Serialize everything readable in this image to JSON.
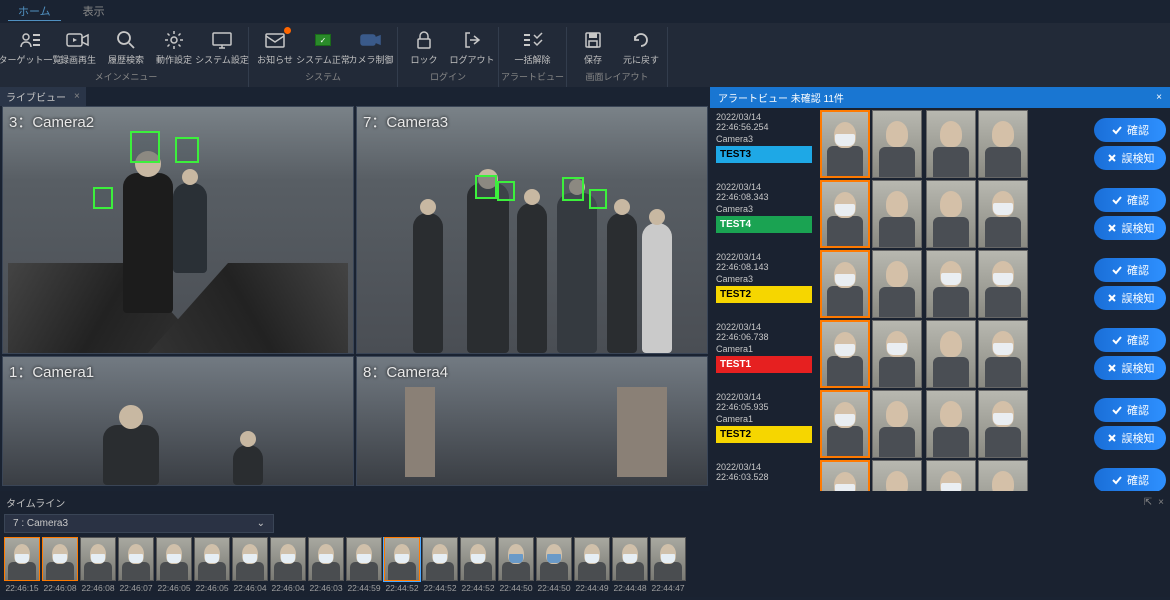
{
  "tabs": {
    "home": "ホーム",
    "view": "表示"
  },
  "toolbar": {
    "groups": [
      {
        "name": "メインメニュー",
        "items": [
          {
            "id": "target-list",
            "label": "ターゲット一覧"
          },
          {
            "id": "record-play",
            "label": "録画再生"
          },
          {
            "id": "history-search",
            "label": "履歴検索"
          },
          {
            "id": "action-settings",
            "label": "動作設定"
          },
          {
            "id": "system-settings",
            "label": "システム設定"
          }
        ]
      },
      {
        "name": "システム",
        "items": [
          {
            "id": "notice",
            "label": "お知らせ",
            "badge": true
          },
          {
            "id": "system-ok",
            "label": "システム正常",
            "green": true
          },
          {
            "id": "camera-ctrl",
            "label": "カメラ制御"
          }
        ]
      },
      {
        "name": "ログイン",
        "items": [
          {
            "id": "lock",
            "label": "ロック"
          },
          {
            "id": "logout",
            "label": "ログアウト"
          }
        ]
      },
      {
        "name": "アラートビュー",
        "items": [
          {
            "id": "bulk-clear",
            "label": "一括解除"
          }
        ]
      },
      {
        "name": "画面レイアウト",
        "items": [
          {
            "id": "save",
            "label": "保存"
          },
          {
            "id": "revert",
            "label": "元に戻す"
          }
        ]
      }
    ]
  },
  "live": {
    "tab_label": "ライブビュー",
    "cameras": [
      {
        "label": "3：Camera2"
      },
      {
        "label": "7：Camera3"
      },
      {
        "label": "1：Camera1"
      },
      {
        "label": "8：Camera4"
      }
    ]
  },
  "alerts": {
    "header": "アラートビュー 未確認 11件",
    "confirm_label": "確認",
    "false_label": "誤検知",
    "rows": [
      {
        "ts": "2022/03/14 22:46:56.254",
        "cam": "Camera3",
        "tag": "TEST3",
        "color": "#1ea8e6"
      },
      {
        "ts": "2022/03/14 22:46:08.343",
        "cam": "Camera3",
        "tag": "TEST4",
        "color": "#1aa352"
      },
      {
        "ts": "2022/03/14 22:46:08.143",
        "cam": "Camera3",
        "tag": "TEST2",
        "color": "#f6d600"
      },
      {
        "ts": "2022/03/14 22:46:06.738",
        "cam": "Camera1",
        "tag": "TEST1",
        "color": "#e62020"
      },
      {
        "ts": "2022/03/14 22:46:05.935",
        "cam": "Camera1",
        "tag": "TEST2",
        "color": "#f6d600"
      },
      {
        "ts": "2022/03/14 22:46:03.528",
        "cam": "",
        "tag": "",
        "color": ""
      }
    ]
  },
  "timeline": {
    "header": "タイムライン",
    "selected_camera": "7 : Camera3",
    "items": [
      {
        "t": "22:46:15",
        "hl": true,
        "mask": "white"
      },
      {
        "t": "22:46:08",
        "hl": true,
        "mask": "white"
      },
      {
        "t": "22:46:08",
        "hl": false,
        "mask": "white"
      },
      {
        "t": "22:46:07",
        "hl": false,
        "mask": "white"
      },
      {
        "t": "22:46:05",
        "hl": false,
        "mask": "white"
      },
      {
        "t": "22:46:05",
        "hl": false,
        "mask": "white"
      },
      {
        "t": "22:46:04",
        "hl": false,
        "mask": "white"
      },
      {
        "t": "22:46:04",
        "hl": false,
        "mask": "white"
      },
      {
        "t": "22:46:03",
        "hl": false,
        "mask": "white"
      },
      {
        "t": "22:44:59",
        "hl": false,
        "mask": "white"
      },
      {
        "t": "22:44:52",
        "hl": true,
        "mask": "white",
        "cur": true
      },
      {
        "t": "22:44:52",
        "hl": false,
        "mask": "white"
      },
      {
        "t": "22:44:52",
        "hl": false,
        "mask": "white"
      },
      {
        "t": "22:44:50",
        "hl": false,
        "mask": "blue"
      },
      {
        "t": "22:44:50",
        "hl": false,
        "mask": "blue"
      },
      {
        "t": "22:44:49",
        "hl": false,
        "mask": "white"
      },
      {
        "t": "22:44:48",
        "hl": false,
        "mask": "white"
      },
      {
        "t": "22:44:47",
        "hl": false,
        "mask": "white"
      }
    ]
  }
}
